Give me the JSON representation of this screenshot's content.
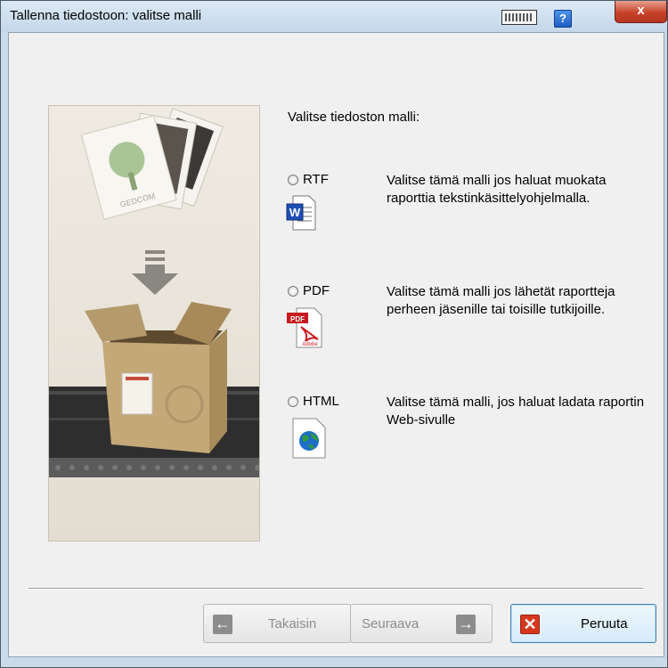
{
  "window": {
    "title": "Tallenna tiedostoon: valitse malli"
  },
  "titlebar": {
    "help_label": "?",
    "close_label": "x"
  },
  "illustration": {
    "card_text": "GEDCOM"
  },
  "prompt": "Valitse tiedoston malli:",
  "options": [
    {
      "label": "RTF",
      "description": "Valitse tämä malli jos haluat muokata raporttia tekstinkäsittelyohjelmalla.",
      "icon": "word-document-icon",
      "selected": false
    },
    {
      "label": "PDF",
      "description": "Valitse tämä malli jos lähetät raportteja perheen jäsenille tai toisille tutkijoille.",
      "icon": "pdf-document-icon",
      "selected": false
    },
    {
      "label": "HTML",
      "description": "Valitse tämä malli, jos haluat ladata raportin Web-sivulle",
      "icon": "web-page-icon",
      "selected": false
    }
  ],
  "buttons": {
    "back_label": "Takaisin",
    "next_label": "Seuraava",
    "cancel_label": "Peruuta"
  },
  "icons": {
    "word_letter": "W",
    "pdf_badge": "PDF",
    "pdf_brand": "Adobe"
  },
  "colors": {
    "accent": "#3c7fb1",
    "cancel_red": "#d6381d"
  }
}
